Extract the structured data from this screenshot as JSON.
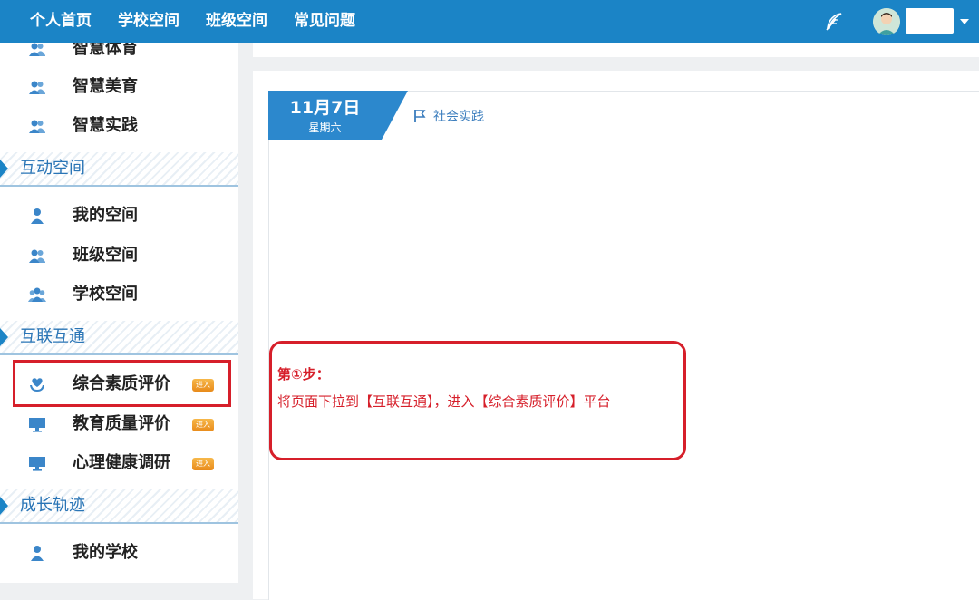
{
  "nav": {
    "items": [
      "个人首页",
      "学校空间",
      "班级空间",
      "常见问题"
    ]
  },
  "sidebar": {
    "items_top": [
      "智慧体育",
      "智慧美育",
      "智慧实践"
    ],
    "sections": [
      {
        "title": "互动空间",
        "items": [
          "我的空间",
          "班级空间",
          "学校空间"
        ]
      },
      {
        "title": "互联互通",
        "items": [
          "综合素质评价",
          "教育质量评价",
          "心理健康调研"
        ]
      },
      {
        "title": "成长轨迹",
        "items": [
          "我的学校"
        ]
      }
    ],
    "badge_text": "进入"
  },
  "main": {
    "date": "11月7日",
    "weekday": "星期六",
    "category": "社会实践"
  },
  "callout": {
    "step": "第①步：",
    "text": "将页面下拉到【互联互通】，进入【综合素质评价】平台"
  },
  "colors": {
    "accent": "#1b84c6",
    "highlight": "#d61f2a",
    "badge": "#f0a030"
  },
  "icons": {
    "user": "user-icon",
    "group": "group-icon",
    "users": "users-icon",
    "monitor": "monitor-icon",
    "heart": "heart-hand-icon",
    "flag": "flag-icon",
    "feather": "feather-icon"
  }
}
